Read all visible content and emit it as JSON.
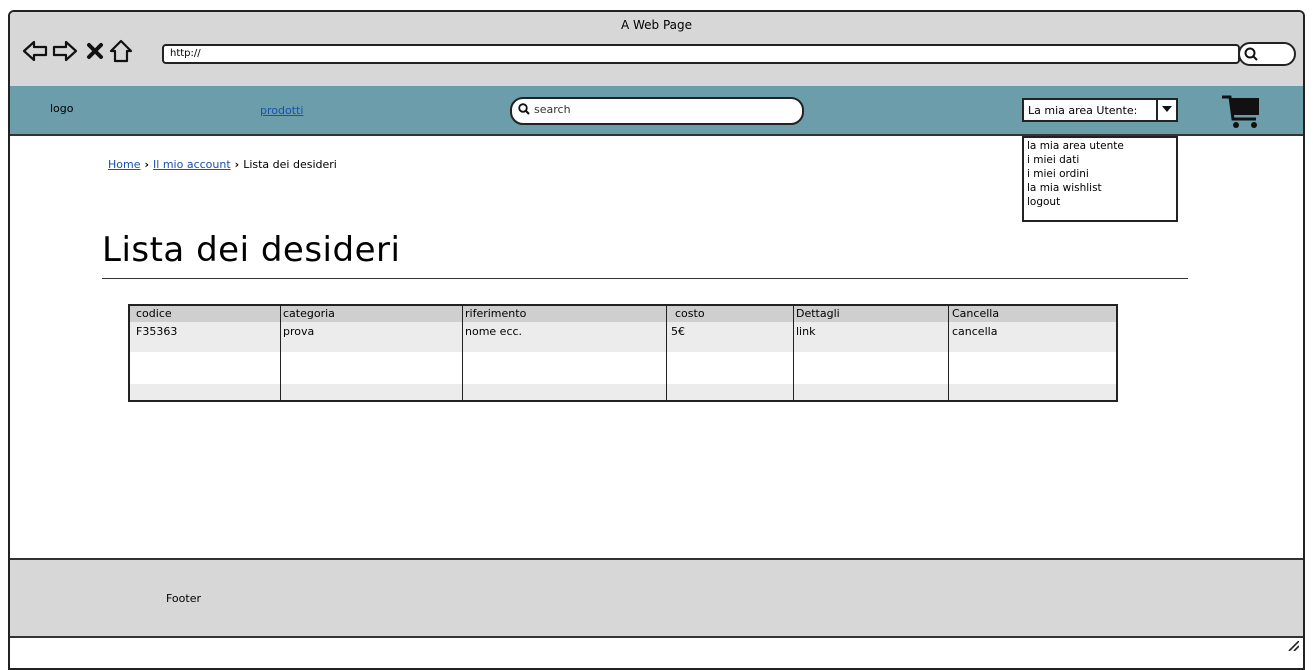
{
  "browser": {
    "window_title": "A Web Page",
    "url": "http://"
  },
  "nav": {
    "logo": "logo",
    "products_link": "prodotti",
    "search_placeholder": "search",
    "user_area_selected": "La mia area Utente:"
  },
  "user_menu": {
    "items": [
      "la mia area utente",
      "i miei dati",
      "i miei ordini",
      "la mia wishlist",
      "logout"
    ]
  },
  "breadcrumb": {
    "home": "Home",
    "account": "Il mio account",
    "current": "Lista dei desideri"
  },
  "page": {
    "title": "Lista dei desideri"
  },
  "wishlist_table": {
    "headers": [
      "codice",
      "categoria",
      "riferimento",
      "costo",
      "Dettagli",
      "Cancella"
    ],
    "rows": [
      [
        "F35363",
        "prova",
        "nome ecc.",
        "5€",
        "link",
        "cancella"
      ]
    ]
  },
  "footer": {
    "label": "Footer"
  }
}
